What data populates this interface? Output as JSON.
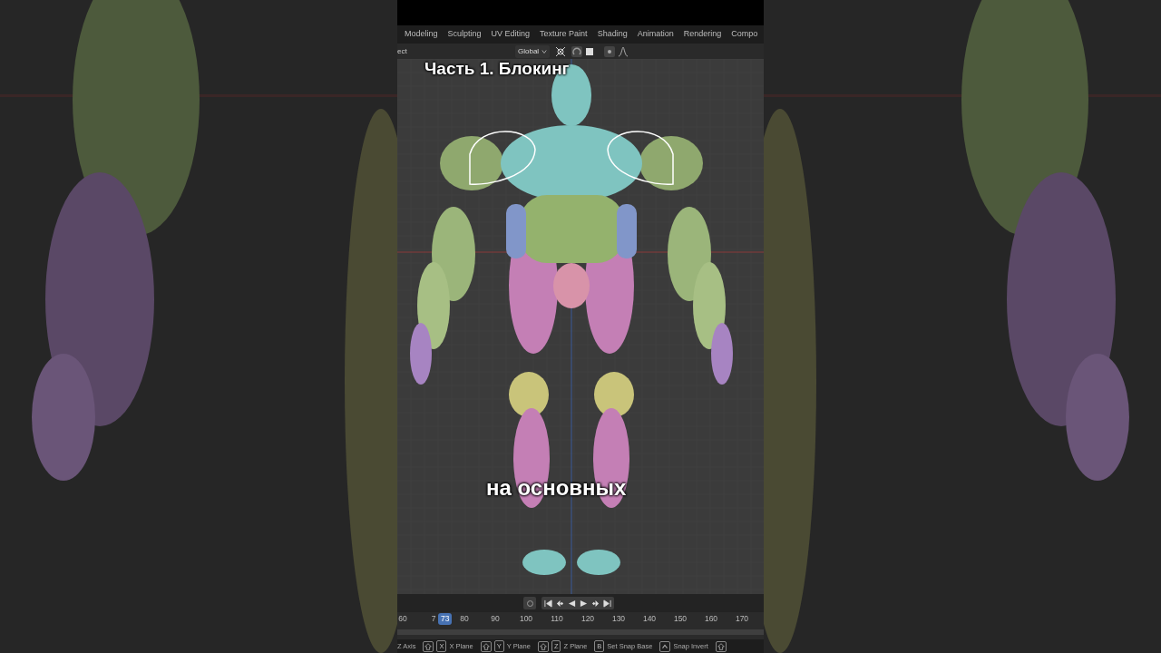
{
  "tabs": [
    "Modeling",
    "Sculpting",
    "UV Editing",
    "Texture Paint",
    "Shading",
    "Animation",
    "Rendering",
    "Compo"
  ],
  "header": {
    "mode_text": "ect",
    "orientation": "Global"
  },
  "captions": {
    "title": "Часть 1. Блокинг",
    "subtitle": "на основных"
  },
  "timeline": {
    "current_frame": "73",
    "ticks": [
      "60",
      "7",
      "80",
      "90",
      "100",
      "110",
      "120",
      "130",
      "140",
      "150",
      "160",
      "170"
    ]
  },
  "status_hints": [
    {
      "label": "Z Axis"
    },
    {
      "keys": [
        {
          "kind": "shift"
        },
        {
          "kind": "key",
          "label": "X"
        }
      ],
      "label": "X Plane"
    },
    {
      "keys": [
        {
          "kind": "shift"
        },
        {
          "kind": "key",
          "label": "Y"
        }
      ],
      "label": "Y Plane"
    },
    {
      "keys": [
        {
          "kind": "shift"
        },
        {
          "kind": "key",
          "label": "Z"
        }
      ],
      "label": "Z Plane"
    },
    {
      "keys": [
        {
          "kind": "key",
          "label": "B"
        }
      ],
      "label": "Set Snap Base"
    },
    {
      "keys": [
        {
          "kind": "ctrl"
        }
      ],
      "label": "Snap Invert"
    },
    {
      "keys": [
        {
          "kind": "shift"
        }
      ]
    }
  ]
}
